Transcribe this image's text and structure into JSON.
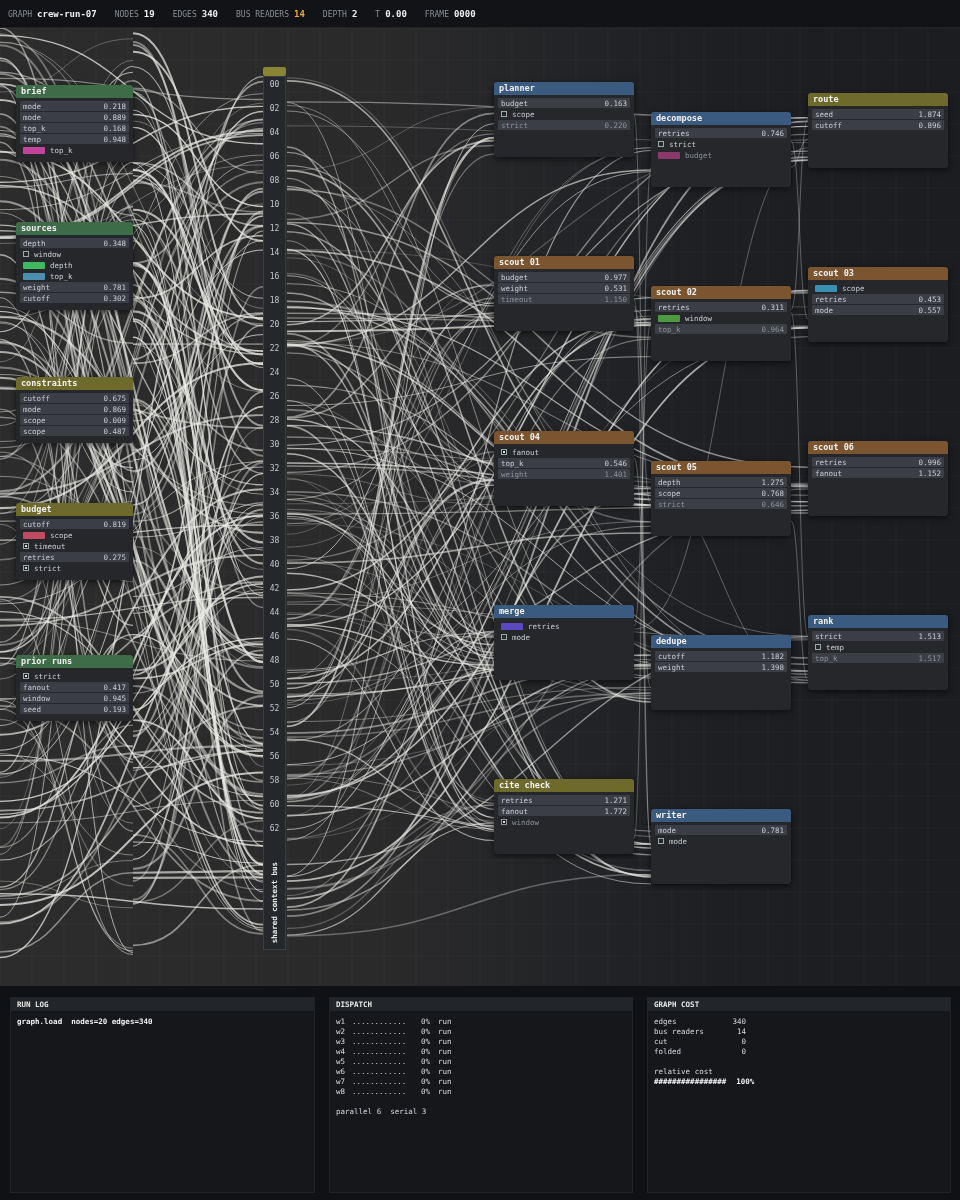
{
  "topbar": [
    {
      "label": "GRAPH",
      "value": "crew-run-07",
      "accent": false
    },
    {
      "label": "NODES",
      "value": "19",
      "accent": false
    },
    {
      "label": "EDGES",
      "value": "340",
      "accent": false
    },
    {
      "label": "BUS READERS",
      "value": "14",
      "accent": true
    },
    {
      "label": "DEPTH",
      "value": "2",
      "accent": false
    },
    {
      "label": "T",
      "value": "0.00",
      "accent": false
    },
    {
      "label": "FRAME",
      "value": "0000",
      "accent": false
    }
  ],
  "nodes": [
    {
      "title": "brief",
      "color": "#3e6b48",
      "rows": [
        {
          "kind": "value",
          "label": "mode",
          "value": "0.218",
          "disabled": false
        },
        {
          "kind": "value",
          "label": "mode",
          "value": "0.889",
          "disabled": false
        },
        {
          "kind": "value",
          "label": "top_k",
          "value": "0.168",
          "disabled": false
        },
        {
          "kind": "value",
          "label": "temp",
          "value": "0.948",
          "disabled": false
        },
        {
          "kind": "swatch",
          "label": "top_k",
          "color": "#c0449c",
          "disabled": false
        }
      ]
    },
    {
      "title": "sources",
      "color": "#3e6b48",
      "rows": [
        {
          "kind": "value",
          "label": "depth",
          "value": "0.348",
          "disabled": false
        },
        {
          "kind": "check",
          "label": "window",
          "checked": false,
          "disabled": false
        },
        {
          "kind": "swatch",
          "label": "depth",
          "color": "#3fb860",
          "disabled": false
        },
        {
          "kind": "swatch",
          "label": "top_k",
          "color": "#4a8fb0",
          "disabled": false
        },
        {
          "kind": "value",
          "label": "weight",
          "value": "0.781",
          "disabled": false
        },
        {
          "kind": "value",
          "label": "cutoff",
          "value": "0.302",
          "disabled": false
        }
      ]
    },
    {
      "title": "constraints",
      "color": "#6e6a2c",
      "rows": [
        {
          "kind": "value",
          "label": "cutoff",
          "value": "0.675",
          "disabled": false
        },
        {
          "kind": "value",
          "label": "mode",
          "value": "0.869",
          "disabled": false
        },
        {
          "kind": "value",
          "label": "scope",
          "value": "0.009",
          "disabled": false
        },
        {
          "kind": "value",
          "label": "scope",
          "value": "0.487",
          "disabled": false
        }
      ]
    },
    {
      "title": "budget",
      "color": "#6e6a2c",
      "rows": [
        {
          "kind": "value",
          "label": "cutoff",
          "value": "0.819",
          "disabled": false
        },
        {
          "kind": "swatch",
          "label": "scope",
          "color": "#c04a60",
          "disabled": false
        },
        {
          "kind": "check",
          "label": "timeout",
          "checked": true,
          "disabled": false
        },
        {
          "kind": "value",
          "label": "retries",
          "value": "0.275",
          "disabled": false
        },
        {
          "kind": "check",
          "label": "strict",
          "checked": true,
          "disabled": false
        }
      ]
    },
    {
      "title": "prior runs",
      "color": "#3e6b48",
      "rows": [
        {
          "kind": "check",
          "label": "strict",
          "checked": true,
          "disabled": false
        },
        {
          "kind": "value",
          "label": "fanout",
          "value": "0.417",
          "disabled": false
        },
        {
          "kind": "value",
          "label": "window",
          "value": "0.945",
          "disabled": false
        },
        {
          "kind": "value",
          "label": "seed",
          "value": "0.193",
          "disabled": false
        }
      ]
    },
    {
      "title": "planner",
      "color": "#3b5a80",
      "rows": [
        {
          "kind": "value",
          "label": "budget",
          "value": "0.163",
          "disabled": false
        },
        {
          "kind": "check",
          "label": "scope",
          "checked": false,
          "disabled": false
        },
        {
          "kind": "value",
          "label": "strict",
          "value": "0.220",
          "disabled": true
        }
      ]
    },
    {
      "title": "decompose",
      "color": "#3b5a80",
      "rows": [
        {
          "kind": "value",
          "label": "retries",
          "value": "0.746",
          "disabled": false
        },
        {
          "kind": "check",
          "label": "strict",
          "checked": false,
          "disabled": false
        },
        {
          "kind": "swatch",
          "label": "budget",
          "color": "#8a3a6a",
          "disabled": true
        }
      ]
    },
    {
      "title": "route",
      "color": "#6e6a2c",
      "rows": [
        {
          "kind": "value",
          "label": "seed",
          "value": "1.874",
          "disabled": false
        },
        {
          "kind": "value",
          "label": "cutoff",
          "value": "0.896",
          "disabled": false
        }
      ]
    },
    {
      "title": "scout 01",
      "color": "#7a5530",
      "rows": [
        {
          "kind": "value",
          "label": "budget",
          "value": "0.977",
          "disabled": false
        },
        {
          "kind": "value",
          "label": "weight",
          "value": "0.531",
          "disabled": false
        },
        {
          "kind": "value",
          "label": "timeout",
          "value": "1.150",
          "disabled": true
        }
      ]
    },
    {
      "title": "scout 02",
      "color": "#7a5530",
      "rows": [
        {
          "kind": "value",
          "label": "retries",
          "value": "0.311",
          "disabled": false
        },
        {
          "kind": "swatch",
          "label": "window",
          "color": "#4e9a40",
          "disabled": false
        },
        {
          "kind": "value",
          "label": "top_k",
          "value": "0.964",
          "disabled": true
        }
      ]
    },
    {
      "title": "scout 03",
      "color": "#7a5530",
      "rows": [
        {
          "kind": "swatch",
          "label": "scope",
          "color": "#3a90b0",
          "disabled": false
        },
        {
          "kind": "value",
          "label": "retries",
          "value": "0.453",
          "disabled": false
        },
        {
          "kind": "value",
          "label": "mode",
          "value": "0.557",
          "disabled": false
        }
      ]
    },
    {
      "title": "scout 04",
      "color": "#7a5530",
      "rows": [
        {
          "kind": "check",
          "label": "fanout",
          "checked": true,
          "disabled": false
        },
        {
          "kind": "value",
          "label": "top_k",
          "value": "0.546",
          "disabled": false
        },
        {
          "kind": "value",
          "label": "weight",
          "value": "1.401",
          "disabled": true
        }
      ]
    },
    {
      "title": "scout 05",
      "color": "#7a5530",
      "rows": [
        {
          "kind": "value",
          "label": "depth",
          "value": "1.275",
          "disabled": false
        },
        {
          "kind": "value",
          "label": "scope",
          "value": "0.768",
          "disabled": false
        },
        {
          "kind": "value",
          "label": "strict",
          "value": "0.646",
          "disabled": true
        }
      ]
    },
    {
      "title": "scout 06",
      "color": "#7a5530",
      "rows": [
        {
          "kind": "value",
          "label": "retries",
          "value": "0.996",
          "disabled": false
        },
        {
          "kind": "value",
          "label": "fanout",
          "value": "1.152",
          "disabled": false
        }
      ]
    },
    {
      "title": "merge",
      "color": "#3b5a80",
      "rows": [
        {
          "kind": "swatch",
          "label": "retries",
          "color": "#5a48c0",
          "disabled": false
        },
        {
          "kind": "check",
          "label": "mode",
          "checked": false,
          "disabled": false
        }
      ]
    },
    {
      "title": "dedupe",
      "color": "#3b5a80",
      "rows": [
        {
          "kind": "value",
          "label": "cutoff",
          "value": "1.182",
          "disabled": false
        },
        {
          "kind": "value",
          "label": "weight",
          "value": "1.398",
          "disabled": false
        }
      ]
    },
    {
      "title": "rank",
      "color": "#3b5a80",
      "rows": [
        {
          "kind": "value",
          "label": "strict",
          "value": "1.513",
          "disabled": false
        },
        {
          "kind": "check",
          "label": "temp",
          "checked": false,
          "disabled": false
        },
        {
          "kind": "value",
          "label": "top_k",
          "value": "1.517",
          "disabled": true
        }
      ]
    },
    {
      "title": "cite check",
      "color": "#6e6a2c",
      "rows": [
        {
          "kind": "value",
          "label": "retries",
          "value": "1.271",
          "disabled": false
        },
        {
          "kind": "value",
          "label": "fanout",
          "value": "1.772",
          "disabled": false
        },
        {
          "kind": "check",
          "label": "window",
          "checked": true,
          "disabled": true
        }
      ]
    },
    {
      "title": "writer",
      "color": "#3b5a80",
      "rows": [
        {
          "kind": "value",
          "label": "mode",
          "value": "0.781",
          "disabled": false
        },
        {
          "kind": "check",
          "label": "mode",
          "checked": false,
          "disabled": false
        }
      ]
    }
  ],
  "bus": {
    "title": "shared context bus",
    "ports": [
      "00",
      "02",
      "04",
      "06",
      "08",
      "10",
      "12",
      "14",
      "16",
      "18",
      "20",
      "22",
      "24",
      "26",
      "28",
      "30",
      "32",
      "34",
      "36",
      "38",
      "40",
      "42",
      "44",
      "46",
      "48",
      "50",
      "52",
      "54",
      "56",
      "58",
      "60",
      "62"
    ]
  },
  "run_log": {
    "title": "RUN LOG",
    "lines": [
      "graph.load  nodes=20 edges=340"
    ]
  },
  "dispatch": {
    "title": "DISPATCH",
    "workers": [
      {
        "name": "w1",
        "dots": "............",
        "percent": "0%",
        "status": "run"
      },
      {
        "name": "w2",
        "dots": "............",
        "percent": "0%",
        "status": "run"
      },
      {
        "name": "w3",
        "dots": "............",
        "percent": "0%",
        "status": "run"
      },
      {
        "name": "w4",
        "dots": "............",
        "percent": "0%",
        "status": "run"
      },
      {
        "name": "w5",
        "dots": "............",
        "percent": "0%",
        "status": "run"
      },
      {
        "name": "w6",
        "dots": "............",
        "percent": "0%",
        "status": "run"
      },
      {
        "name": "w7",
        "dots": "............",
        "percent": "0%",
        "status": "run"
      },
      {
        "name": "w8",
        "dots": "............",
        "percent": "0%",
        "status": "run"
      }
    ],
    "footer": "parallel 6  serial 3"
  },
  "graph_cost": {
    "title": "GRAPH COST",
    "rows": [
      {
        "label": "edges",
        "value": "340"
      },
      {
        "label": "bus readers",
        "value": "14"
      },
      {
        "label": "cut",
        "value": "0"
      },
      {
        "label": "folded",
        "value": "0"
      }
    ],
    "cost_label": "relative cost",
    "cost_bar": "################",
    "cost_percent": "100%"
  }
}
